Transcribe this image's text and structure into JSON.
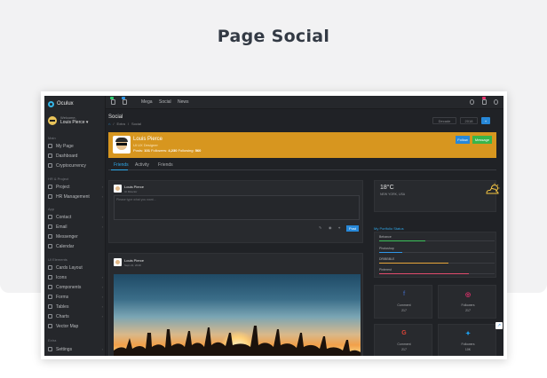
{
  "banner": {
    "title": "Page Social"
  },
  "app": {
    "brand": "Oculux",
    "user": {
      "greeting": "Welcome,",
      "name": "Louis Pierce ▾"
    },
    "sidebar": {
      "sections": [
        {
          "label": "Main"
        },
        {
          "label": "HR & Project"
        },
        {
          "label": "App"
        },
        {
          "label": "UI Elements"
        },
        {
          "label": "Extra"
        }
      ],
      "items": [
        {
          "label": "My Page",
          "icon": "home-icon"
        },
        {
          "label": "Dashboard",
          "icon": "dashboard-icon"
        },
        {
          "label": "Cryptocurrency",
          "icon": "bitcoin-icon"
        },
        {
          "label": "Project",
          "icon": "project-icon"
        },
        {
          "label": "HR Management",
          "icon": "users-icon"
        },
        {
          "label": "Contact",
          "icon": "contact-icon"
        },
        {
          "label": "Email",
          "icon": "email-icon"
        },
        {
          "label": "Messenger",
          "icon": "messenger-icon"
        },
        {
          "label": "Calendar",
          "icon": "calendar-icon"
        },
        {
          "label": "Cards Layout",
          "icon": "cards-icon"
        },
        {
          "label": "Icons",
          "icon": "icons-icon"
        },
        {
          "label": "Components",
          "icon": "components-icon"
        },
        {
          "label": "Forms",
          "icon": "forms-icon"
        },
        {
          "label": "Tables",
          "icon": "tables-icon"
        },
        {
          "label": "Charts",
          "icon": "charts-icon"
        },
        {
          "label": "Vector Map",
          "icon": "map-icon"
        },
        {
          "label": "Settings",
          "icon": "settings-icon"
        }
      ]
    },
    "topbar": {
      "links": [
        "Mega",
        "Social",
        "News"
      ],
      "colors": {
        "badge_green": "#2ecc71",
        "badge_blue": "#2f96e8",
        "badge_pink": "#e8336e"
      }
    },
    "header": {
      "title": "Social",
      "breadcrumb": [
        "Extra",
        "Social"
      ],
      "buttons": [
        "Decade",
        "2018",
        "+"
      ]
    },
    "profile": {
      "name": "Louis Pierce",
      "role": "UI UX Designer",
      "posts_label": "Posts:",
      "posts": "101",
      "followers_label": "Followers:",
      "followers": "4,230",
      "following_label": "Following:",
      "following": "560",
      "follow_btn": "Follow",
      "message_btn": "Message",
      "color": "#d7961f"
    },
    "tabs": [
      "Friends",
      "Activity",
      "Friends"
    ],
    "composer": {
      "name": "Louis Pierce",
      "role": "UI Director",
      "placeholder": "Please type what you want...",
      "post_btn": "Post"
    },
    "post": {
      "name": "Louis Pierce",
      "date": "Sept 22, 2018"
    },
    "weather": {
      "temp": "18°C",
      "location": "NEW YORK, USA"
    },
    "portfolio": {
      "title": "My Portfolio Status",
      "skills": [
        {
          "label": "Behance",
          "value": 0.4,
          "color": "#3cc25a"
        },
        {
          "label": "Photoshop",
          "value": 0.2,
          "color": "#2f96e8"
        },
        {
          "label": "DRIBBBLE",
          "value": 0.6,
          "color": "#e8a63a"
        },
        {
          "label": "Pinterest",
          "value": 0.78,
          "color": "#e24b6d"
        }
      ]
    },
    "social": [
      {
        "icon": "facebook-icon",
        "glyph": "f",
        "label": "Comment",
        "value": "217",
        "color": "#3b5998"
      },
      {
        "icon": "instagram-icon",
        "glyph": "◎",
        "label": "Followers",
        "value": "217",
        "color": "#e1306c"
      },
      {
        "icon": "google-icon",
        "glyph": "G",
        "label": "Comment",
        "value": "217",
        "color": "#db4437"
      },
      {
        "icon": "twitter-icon",
        "glyph": "✦",
        "label": "Followers",
        "value": "10K",
        "color": "#1da1f2"
      }
    ]
  }
}
